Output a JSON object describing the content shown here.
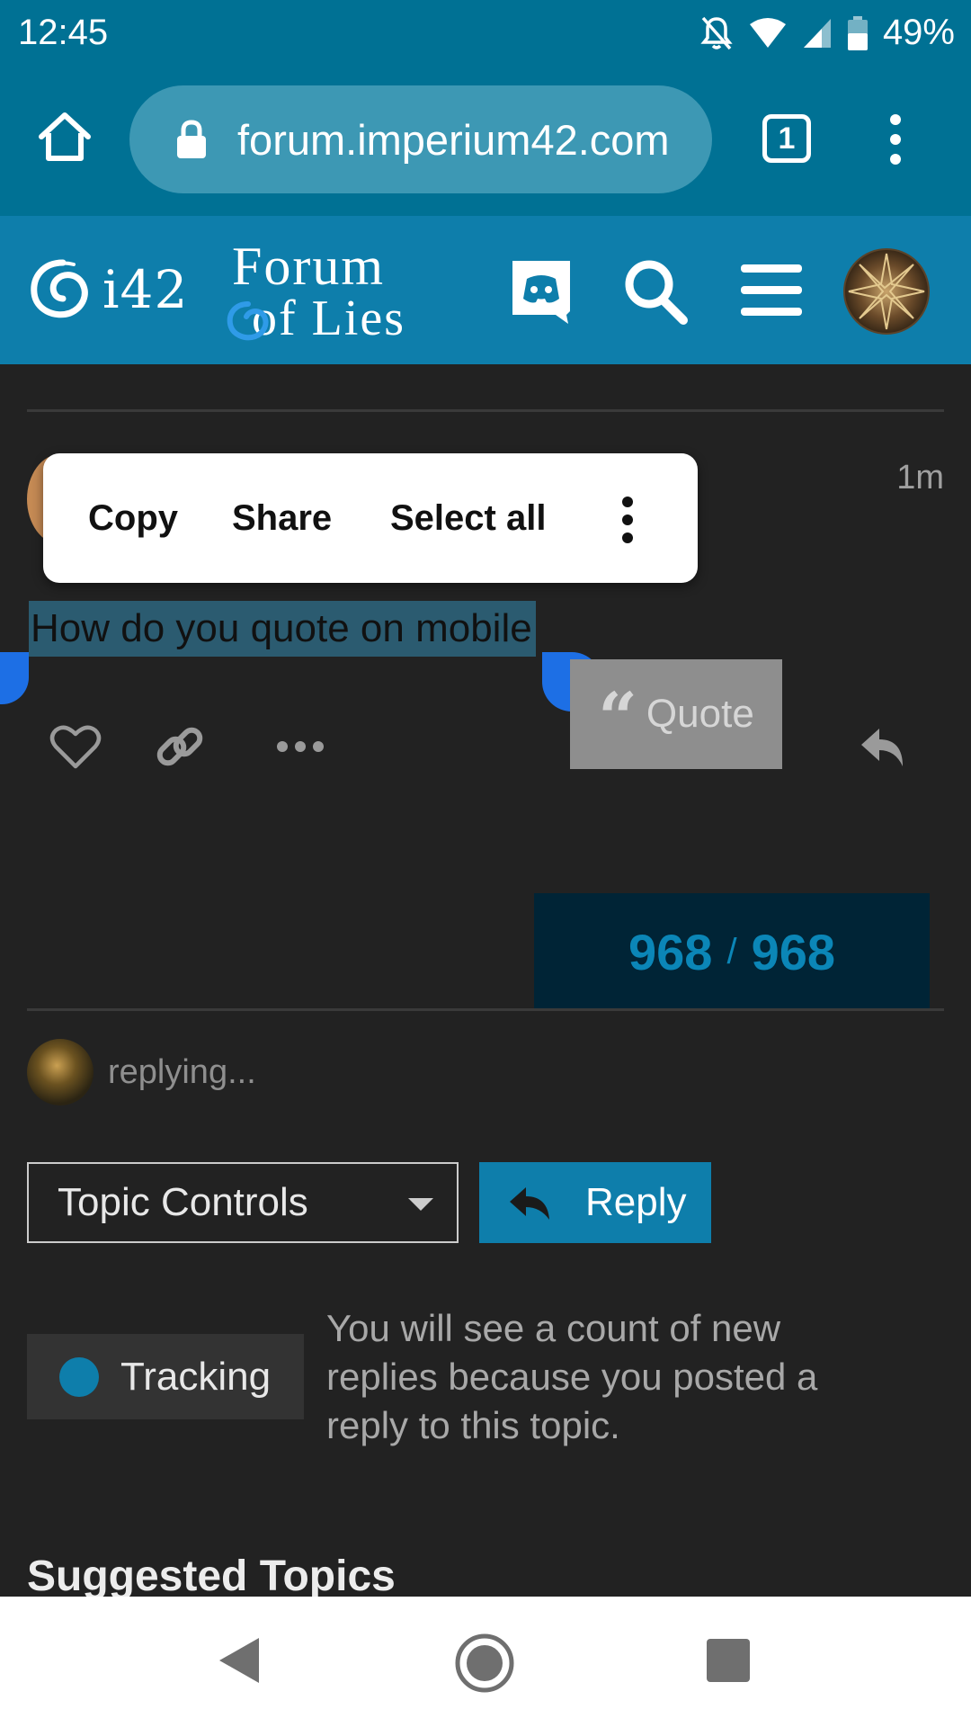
{
  "status_bar": {
    "time": "12:45",
    "battery": "49%",
    "icons": [
      "do-not-disturb-icon",
      "wifi-icon",
      "signal-icon",
      "battery-icon"
    ]
  },
  "browser": {
    "url": "forum.imperium42.com",
    "tab_count": "1"
  },
  "site_header": {
    "brand": "i42",
    "forum_title_line1": "Forum",
    "forum_title_line2": "of Lies",
    "icons": [
      "discord-icon",
      "search-icon",
      "hamburger-menu-icon",
      "user-avatar"
    ]
  },
  "post": {
    "time": "1m",
    "selected_text": "How do you quote on mobile",
    "quote_label": "Quote"
  },
  "context_menu": {
    "copy": "Copy",
    "share": "Share",
    "select_all": "Select all"
  },
  "progress": {
    "current": "968",
    "separator": "/",
    "total": "968"
  },
  "replying": {
    "text": "replying..."
  },
  "controls": {
    "topic_controls_label": "Topic Controls",
    "reply_label": "Reply"
  },
  "notification": {
    "level": "Tracking",
    "description": "You will see a count of new replies because you posted a reply to this topic."
  },
  "suggested": {
    "heading": "Suggested Topics"
  },
  "colors": {
    "status_bar": "#007194",
    "header": "#0e7eab",
    "background": "#222222",
    "accent": "#0e7eab",
    "progress_bg": "#002436",
    "selection_handle": "#1d6fe5"
  }
}
